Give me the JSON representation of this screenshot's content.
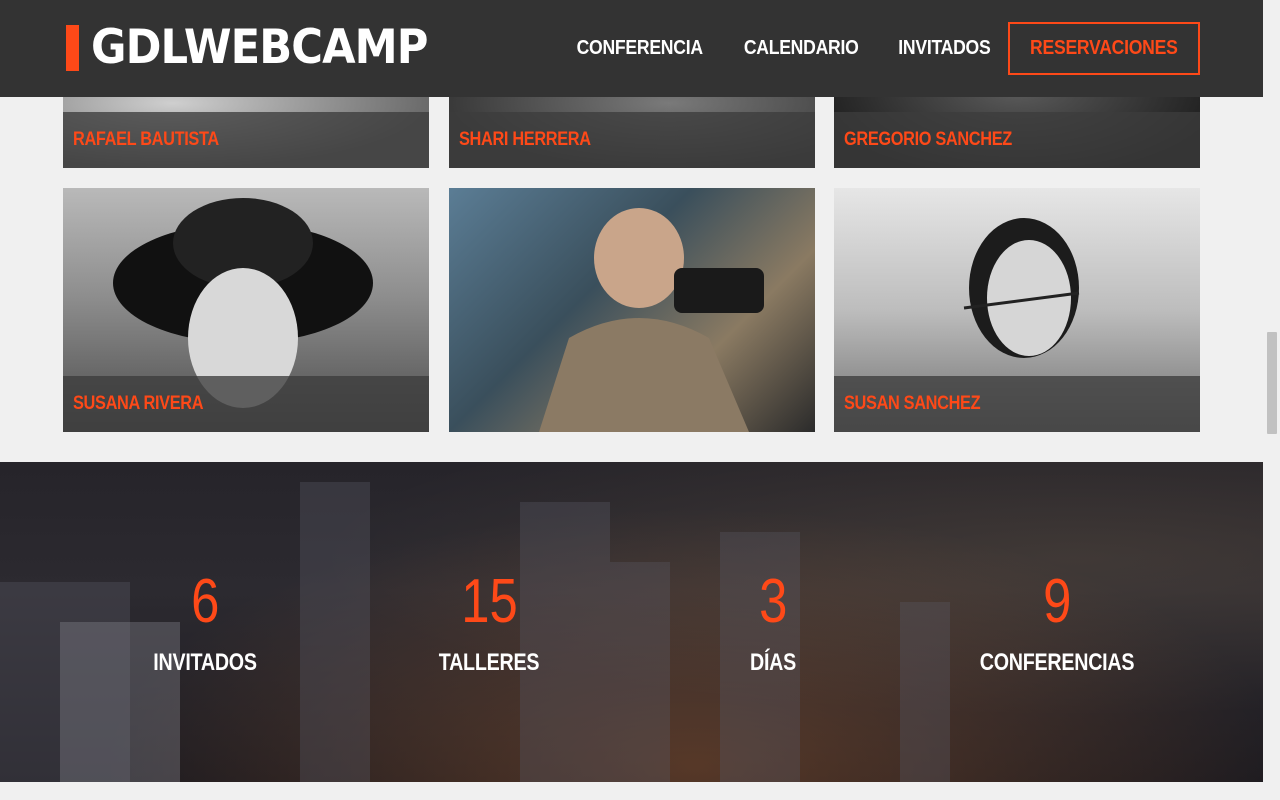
{
  "header": {
    "logo_text": "GDLWEBCAMP",
    "nav": [
      {
        "label": "CONFERENCIA"
      },
      {
        "label": "CALENDARIO"
      },
      {
        "label": "INVITADOS"
      },
      {
        "label": "RESERVACIONES"
      }
    ]
  },
  "speakers": [
    {
      "name": "RAFAEL BAUTISTA"
    },
    {
      "name": "SHARI HERRERA"
    },
    {
      "name": "GREGORIO SANCHEZ"
    },
    {
      "name": "SUSANA RIVERA"
    },
    {
      "name": ""
    },
    {
      "name": "SUSAN SANCHEZ"
    }
  ],
  "stats": [
    {
      "value": "6",
      "label": "INVITADOS"
    },
    {
      "value": "15",
      "label": "TALLERES"
    },
    {
      "value": "3",
      "label": "DÍAS"
    },
    {
      "value": "9",
      "label": "CONFERENCIAS"
    }
  ],
  "colors": {
    "accent": "#fe4918",
    "header_bg": "#333333",
    "page_bg": "#f0f0f0"
  }
}
